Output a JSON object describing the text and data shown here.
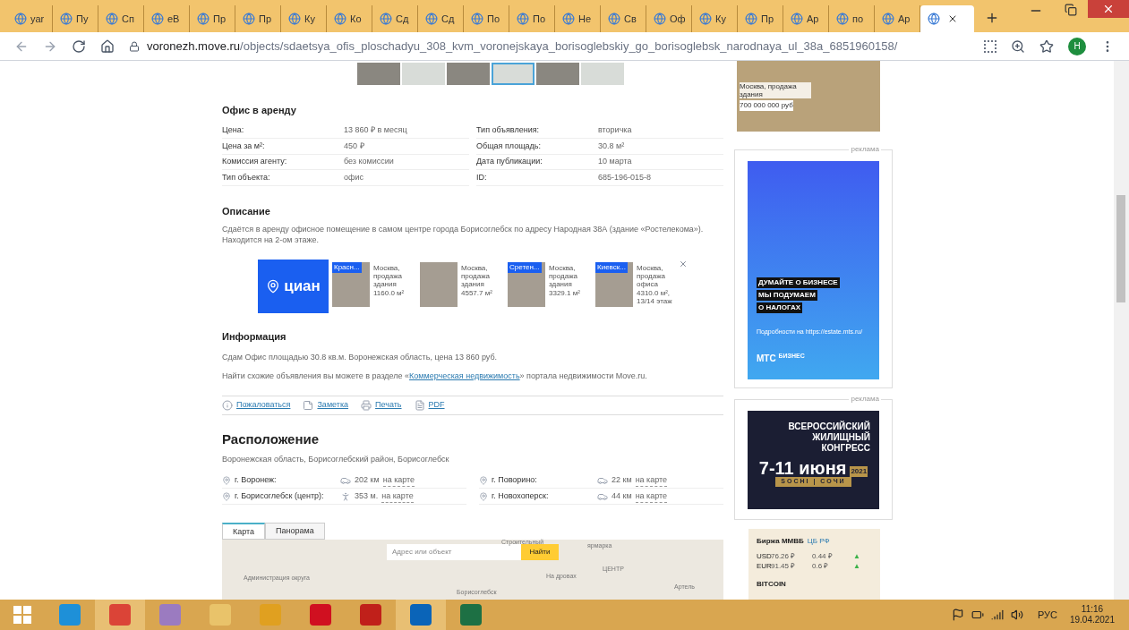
{
  "browser": {
    "tabs": [
      {
        "label": "yar",
        "selected": false
      },
      {
        "label": "Пу",
        "selected": false
      },
      {
        "label": "Сп",
        "selected": false
      },
      {
        "label": "eB",
        "selected": false
      },
      {
        "label": "Пр",
        "selected": false
      },
      {
        "label": "Пр",
        "selected": false
      },
      {
        "label": "Ку",
        "selected": false
      },
      {
        "label": "Ко",
        "selected": false
      },
      {
        "label": "Сд",
        "selected": false
      },
      {
        "label": "Сд",
        "selected": false
      },
      {
        "label": "По",
        "selected": false
      },
      {
        "label": "По",
        "selected": false
      },
      {
        "label": "Не",
        "selected": false
      },
      {
        "label": "Св",
        "selected": false
      },
      {
        "label": "Оф",
        "selected": false
      },
      {
        "label": "Ку",
        "selected": false
      },
      {
        "label": "Пр",
        "selected": false
      },
      {
        "label": "Ар",
        "selected": false
      },
      {
        "label": "по",
        "selected": false
      },
      {
        "label": "Ар",
        "selected": false
      },
      {
        "selected": true
      }
    ],
    "url_domain": "voronezh.move.ru",
    "url_path": "/objects/sdaetsya_ofis_ploschadyu_308_kvm_voronejskaya_borisoglebskiy_go_borisoglebsk_narodnaya_ul_38a_6851960158/",
    "profile": "Н"
  },
  "gallery": [
    {
      "selected": false
    },
    {
      "selected": false
    },
    {
      "selected": false
    },
    {
      "selected": true
    },
    {
      "selected": false
    },
    {
      "selected": false
    }
  ],
  "listing": {
    "title": "Офис в аренду",
    "left": [
      {
        "label": "Цена:",
        "value": "13 860 ₽ в месяц"
      },
      {
        "label": "Цена за м²:",
        "value": "450 ₽"
      },
      {
        "label": "Комиссия агенту:",
        "value": "без комиссии"
      },
      {
        "label": "Тип объекта:",
        "value": "офис"
      }
    ],
    "right": [
      {
        "label": "Тип объявления:",
        "value": "вторичка"
      },
      {
        "label": "Общая площадь:",
        "value": "30.8 м²"
      },
      {
        "label": "Дата публикации:",
        "value": "10 марта"
      },
      {
        "label": "ID:",
        "value": "685-196-015-8"
      }
    ]
  },
  "description": {
    "title": "Описание",
    "text": "Сдаётся в аренду офисное помещение в самом центре города Борисоглебск по адресу Народная 38А (здание «Ростелекома»). Находится на 2-ом этаже."
  },
  "cian_ad": {
    "logo": "циан",
    "items": [
      {
        "badge": "Красн...",
        "text": "Москва, продажа здания",
        "area": "1160.0 м²"
      },
      {
        "text": "Москва, продажа здания",
        "area": "4557.7 м²"
      },
      {
        "badge": "Сретен...",
        "text": "Москва, продажа здания",
        "area": "3329.1 м²"
      },
      {
        "badge": "Киевск...",
        "text": "Москва, продажа офиса",
        "area": "4310.0 м², 13/14 этаж"
      }
    ]
  },
  "information": {
    "title": "Информация",
    "line": "Сдам Офис площадью 30.8 кв.м. Воронежская область, цена 13 860 руб.",
    "similar_before": "Найти схожие объявления вы можете в разделе «",
    "similar_link": "Коммерческая недвижимость",
    "similar_after": "» портала недвижимости Move.ru."
  },
  "actions": [
    {
      "kind": "info",
      "label": "Пожаловаться"
    },
    {
      "kind": "note",
      "label": "Заметка"
    },
    {
      "kind": "print",
      "label": "Печать"
    },
    {
      "kind": "pdf",
      "label": "PDF"
    }
  ],
  "location": {
    "title": "Расположение",
    "region": "Воронежская область, Борисоглебский район, Борисоглебск",
    "places": [
      {
        "name": "г. Воронеж:",
        "kind": "car",
        "distance": "202 км",
        "link": "на карте"
      },
      {
        "name": "г. Поворино:",
        "kind": "car",
        "distance": "22 км",
        "link": "на карте"
      },
      {
        "name": "г. Борисоглебск (центр):",
        "kind": "walk",
        "distance": "353 м.",
        "link": "на карте"
      },
      {
        "name": "г. Новохоперск:",
        "kind": "car",
        "distance": "44 км",
        "link": "на карте"
      }
    ]
  },
  "map": {
    "tabs": [
      {
        "label": "Карта",
        "selected": true
      },
      {
        "label": "Панорама",
        "selected": false
      }
    ],
    "placeholder": "Адрес или объект",
    "button": "Найти",
    "labels": [
      "Администрация округа",
      "На дровах",
      "Борисоглебск",
      "ЦЕНТР",
      "Артель",
      "Строительный",
      "ярмарка"
    ]
  },
  "sidebar": {
    "top_ad": {
      "text": "Москва, продажа здания",
      "price": "700 000 000 руб"
    },
    "mts_ad": {
      "label": "реклама",
      "lines": [
        "ДУМАЙТЕ О БИЗНЕСЕ",
        "МЫ ПОДУМАЕМ",
        "О НАЛОГАХ"
      ],
      "note": "Подробности на https://estate.mts.ru/",
      "brand": "МТС",
      "brand_sub": "БИЗНЕС"
    },
    "congress_ad": {
      "label": "реклама",
      "lines": [
        "ВСЕРОССИЙСКИЙ",
        "ЖИЛИЩНЫЙ",
        "КОНГРЕСС"
      ],
      "dates": "7-11 июня",
      "year": "2021",
      "city": "SOCHI | СОЧИ"
    },
    "exchange": {
      "title": "Биржа ММВБ",
      "link": "ЦБ РФ",
      "rows": [
        {
          "code": "USD",
          "rate": "76.26 ₽",
          "change": "0.44 ₽",
          "up": true,
          "trend": "▲"
        },
        {
          "code": "EUR",
          "rate": "91.45 ₽",
          "change": "0.6 ₽",
          "up": true,
          "trend": "▲"
        }
      ],
      "crypto": "BITCOIN"
    }
  },
  "taskbar": {
    "apps": [
      {
        "kind": "ie",
        "selected": false
      },
      {
        "kind": "chrome",
        "selected": true
      },
      {
        "kind": "paint",
        "selected": false
      },
      {
        "kind": "explorer",
        "selected": false
      },
      {
        "kind": "chart",
        "selected": false
      },
      {
        "kind": "opera",
        "selected": false
      },
      {
        "kind": "pdf",
        "selected": false
      },
      {
        "kind": "outlook",
        "selected": true
      },
      {
        "kind": "excel",
        "selected": false
      }
    ],
    "language": "РУС",
    "time": "11:16",
    "date": "19.04.2021"
  }
}
